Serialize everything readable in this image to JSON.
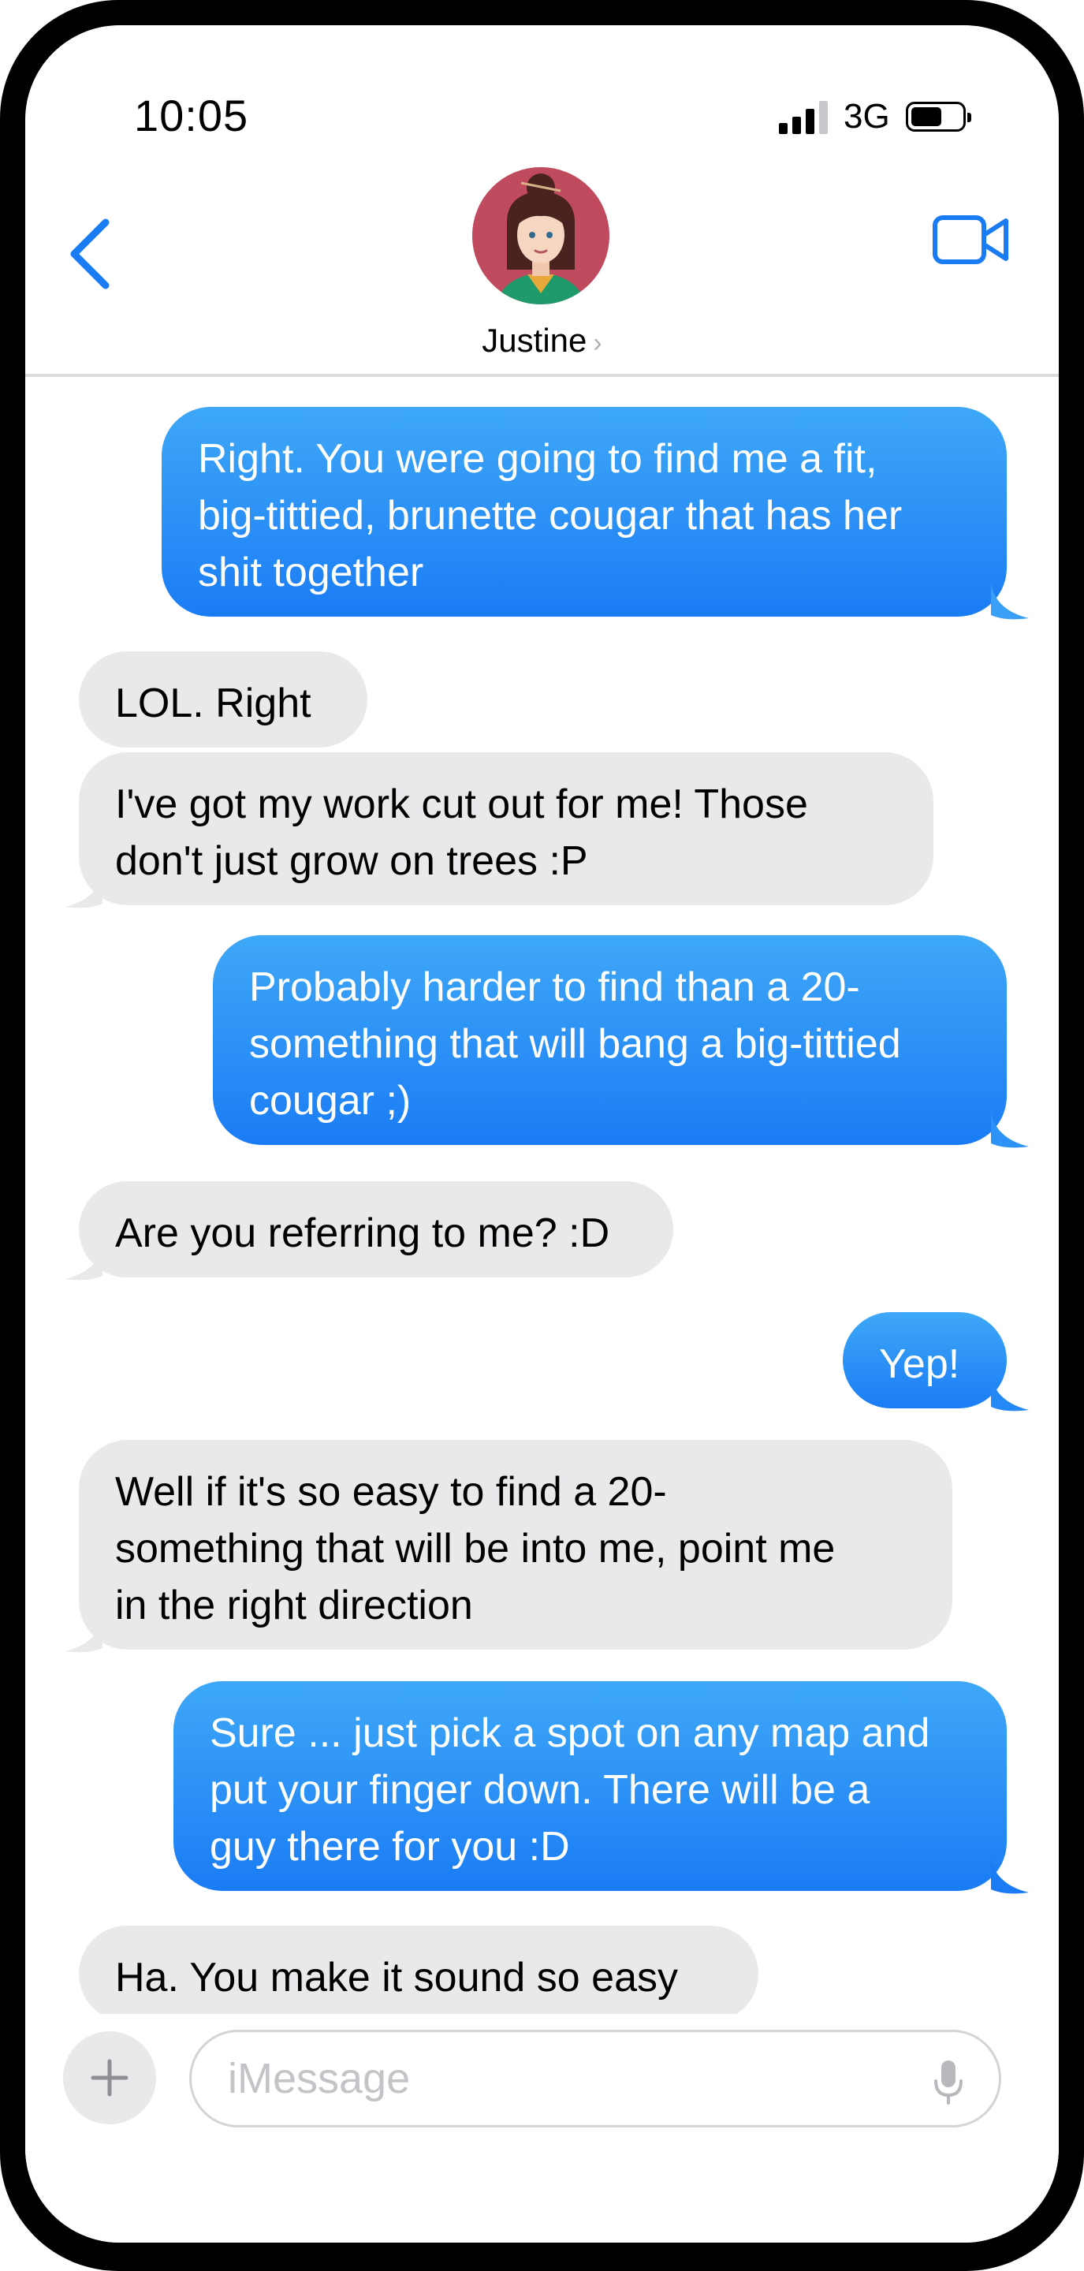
{
  "status_bar": {
    "time": "10:05",
    "network": "3G",
    "battery_level": 0.6
  },
  "header": {
    "contact_name": "Justine",
    "back_icon": "chevron-left-icon",
    "video_icon": "video-camera-icon"
  },
  "messages": [
    {
      "direction": "sent",
      "text": "Right.  You were going to find me a fit,\nbig-tittied, brunette cougar that has her\nshit together"
    },
    {
      "direction": "received",
      "text": "LOL.  Right"
    },
    {
      "direction": "received",
      "text": "I've got my work cut out for me!  Those\ndon't just grow on trees :P"
    },
    {
      "direction": "sent",
      "text": "Probably harder to find than a 20-\nsomething that will bang a big-tittied\ncougar ;)"
    },
    {
      "direction": "received",
      "text": "Are you referring to me? :D"
    },
    {
      "direction": "sent",
      "text": "Yep!"
    },
    {
      "direction": "received",
      "text": "Well if it's so easy to find a 20-\nsomething that will be into me, point me\nin the right direction"
    },
    {
      "direction": "sent",
      "text": "Sure ... just pick a spot on any map and\nput your finger down.  There will be a\nguy there for you :D"
    },
    {
      "direction": "received",
      "text": "Ha.  You make it sound so easy"
    }
  ],
  "input_bar": {
    "placeholder": "iMessage",
    "value": "",
    "plus_icon": "plus-icon",
    "mic_icon": "microphone-icon"
  },
  "colors": {
    "accent": "#1a7cf5",
    "sent_top": "#3ea8f7",
    "sent_bottom": "#1a7cf5",
    "received": "#e9e9eb"
  }
}
